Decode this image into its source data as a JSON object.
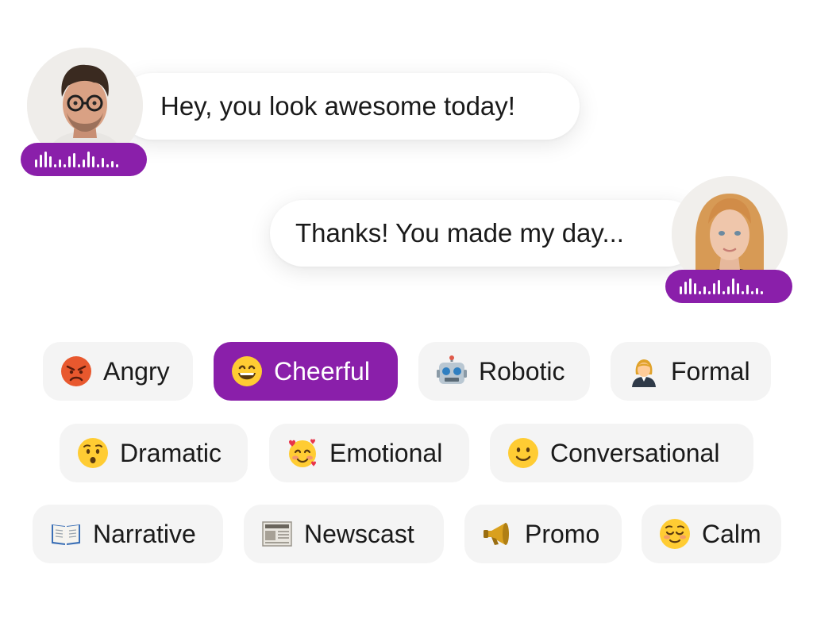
{
  "conversation": {
    "messages": [
      {
        "text": "Hey, you look awesome today!"
      },
      {
        "text": "Thanks! You made my day..."
      }
    ]
  },
  "styles": [
    {
      "label": "Angry",
      "icon": "angry-face-icon"
    },
    {
      "label": "Cheerful",
      "icon": "grinning-face-icon",
      "selected": true
    },
    {
      "label": "Robotic",
      "icon": "robot-icon"
    },
    {
      "label": "Formal",
      "icon": "office-worker-icon"
    },
    {
      "label": "Dramatic",
      "icon": "hushed-face-icon"
    },
    {
      "label": "Emotional",
      "icon": "smiling-face-with-hearts-icon"
    },
    {
      "label": "Conversational",
      "icon": "slightly-smiling-face-icon"
    },
    {
      "label": "Narrative",
      "icon": "open-book-icon"
    },
    {
      "label": "Newscast",
      "icon": "newspaper-icon"
    },
    {
      "label": "Promo",
      "icon": "megaphone-icon"
    },
    {
      "label": "Calm",
      "icon": "relieved-face-icon"
    }
  ],
  "colors": {
    "accent": "#8a1faa",
    "chip_background": "#f4f4f4",
    "bubble_background": "#ffffff"
  }
}
